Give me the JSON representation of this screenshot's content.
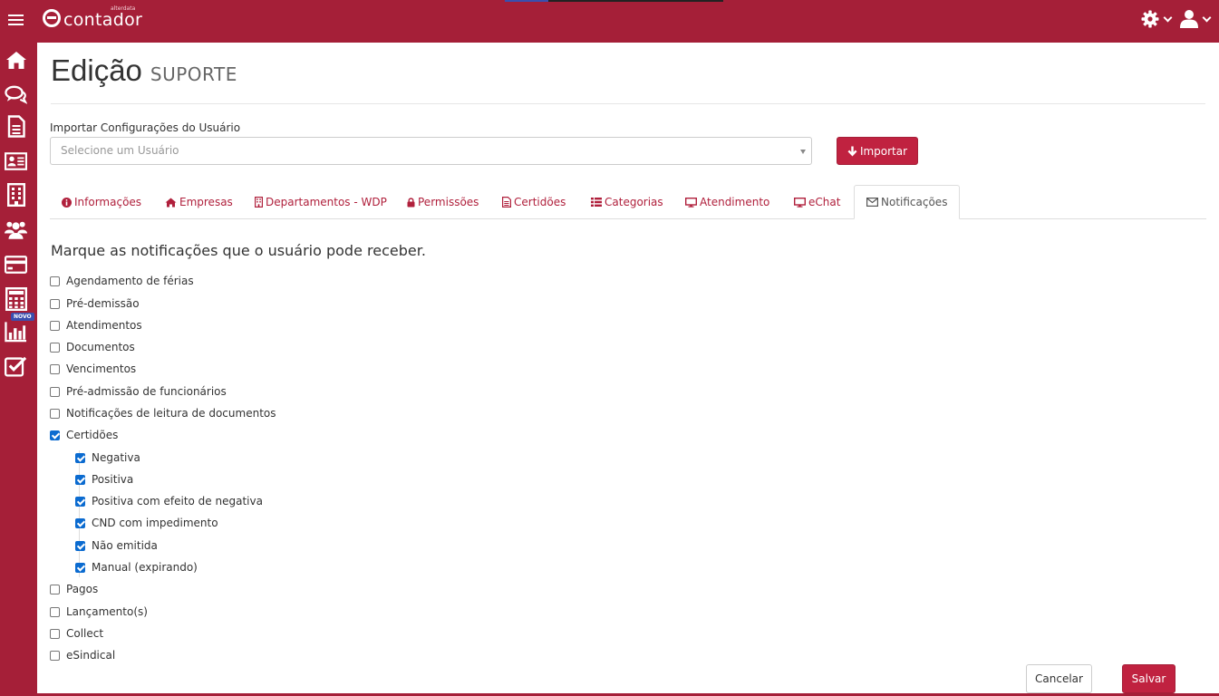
{
  "app": {
    "brand": "contador",
    "brand_small": "alterdata"
  },
  "header": {
    "title": "Edição",
    "subtitle": "SUPORTE"
  },
  "import": {
    "label": "Importar Configurações do Usuário",
    "placeholder": "Selecione um Usuário",
    "button_label": "Importar"
  },
  "tabs": [
    {
      "label": "Informações",
      "icon": "info-circle-icon"
    },
    {
      "label": "Empresas",
      "icon": "home-icon"
    },
    {
      "label": "Departamentos - WDP",
      "icon": "building-icon"
    },
    {
      "label": "Permissões",
      "icon": "lock-icon"
    },
    {
      "label": "Certidões",
      "icon": "file-text-icon"
    },
    {
      "label": "Categorias",
      "icon": "list-icon"
    },
    {
      "label": "Atendimento",
      "icon": "monitor-icon"
    },
    {
      "label": "eChat",
      "icon": "monitor-icon"
    },
    {
      "label": "Notificações",
      "icon": "envelope-icon",
      "active": true
    }
  ],
  "notifications": {
    "question": "Marque as notificações que o usuário pode receber.",
    "items": [
      {
        "label": "Agendamento de férias",
        "checked": false
      },
      {
        "label": "Pré-demissão",
        "checked": false
      },
      {
        "label": "Atendimentos",
        "checked": false
      },
      {
        "label": "Documentos",
        "checked": false
      },
      {
        "label": "Vencimentos",
        "checked": false
      },
      {
        "label": "Pré-admissão de funcionários",
        "checked": false
      },
      {
        "label": "Notificações de leitura de documentos",
        "checked": false
      },
      {
        "label": "Certidões",
        "checked": true
      },
      {
        "label": "Negativa",
        "checked": true,
        "nested": true
      },
      {
        "label": "Positiva",
        "checked": true,
        "nested": true
      },
      {
        "label": "Positiva com efeito de negativa",
        "checked": true,
        "nested": true
      },
      {
        "label": "CND com impedimento",
        "checked": true,
        "nested": true
      },
      {
        "label": "Não emitida",
        "checked": true,
        "nested": true
      },
      {
        "label": "Manual (expirando)",
        "checked": true,
        "nested": true
      },
      {
        "label": "Pagos",
        "checked": false
      },
      {
        "label": "Lançamento(s)",
        "checked": false
      },
      {
        "label": "Collect",
        "checked": false
      },
      {
        "label": "eSindical",
        "checked": false
      }
    ]
  },
  "sidebar": {
    "icons": [
      "home-icon",
      "chat-icon",
      "document-icon",
      "contact-card-icon",
      "building-icon",
      "users-icon",
      "credit-card-icon",
      "calculator-icon",
      "bar-chart-icon",
      "checkbox-icon"
    ],
    "badge": "NOVO"
  },
  "footer": {
    "cancel_label": "Cancelar",
    "save_label": "Salvar"
  },
  "colors": {
    "brand": "#a51f38",
    "button": "#c02240",
    "checkbox": "#0b6bd0"
  }
}
